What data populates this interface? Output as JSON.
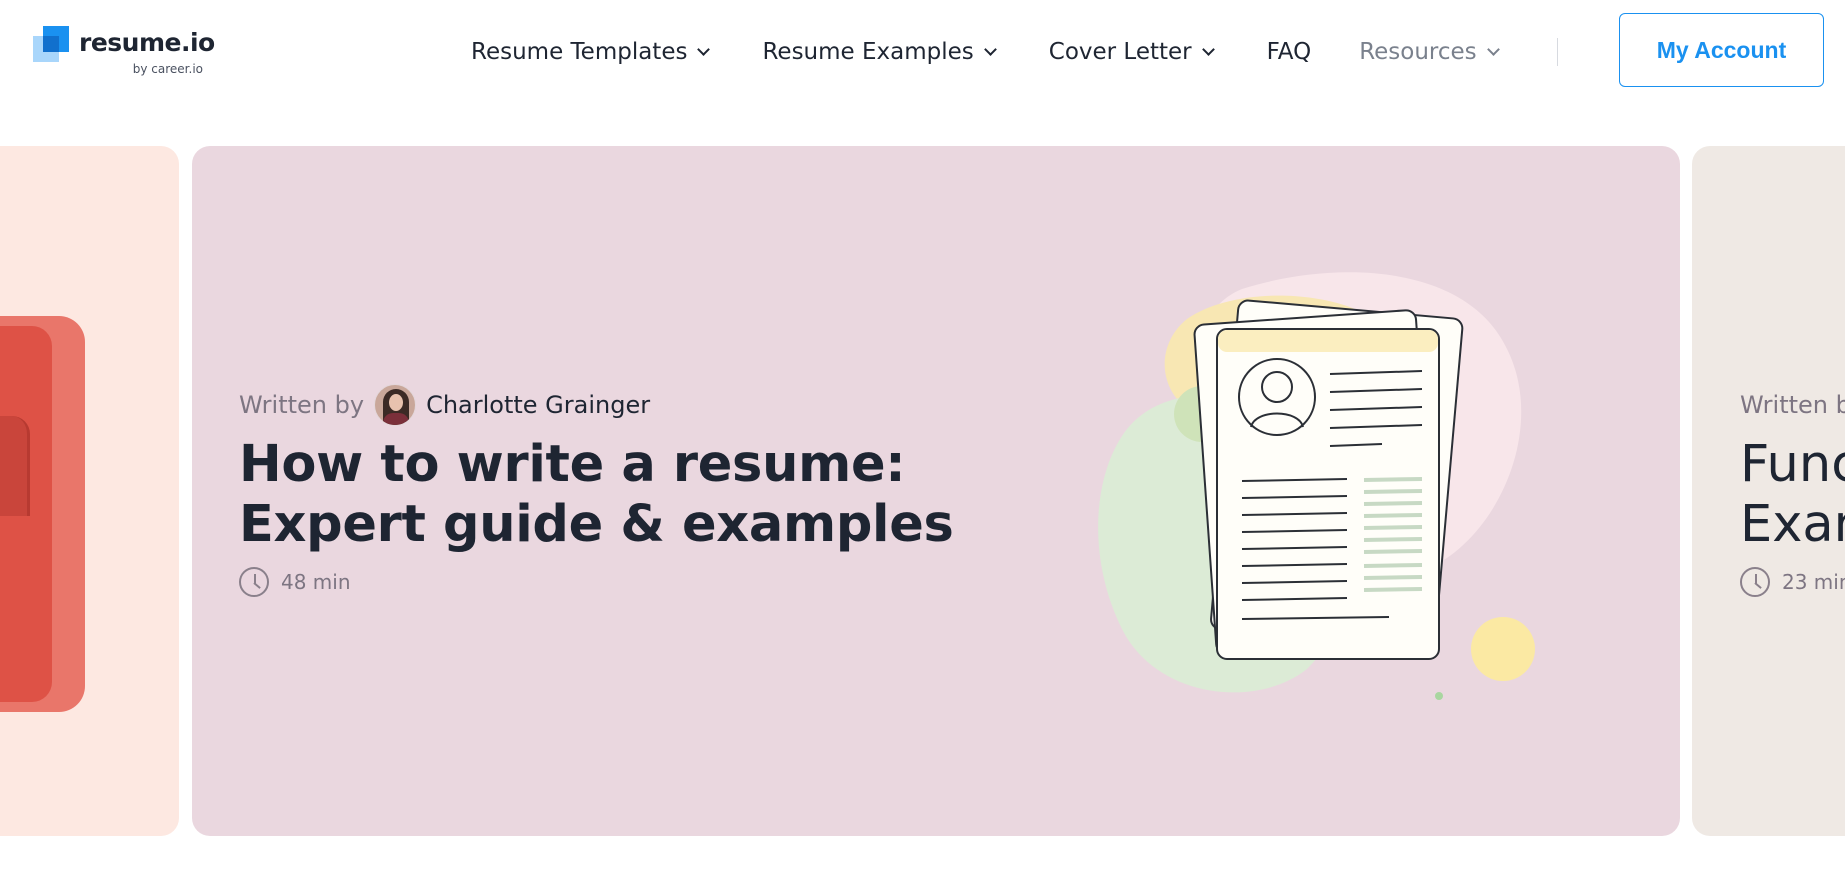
{
  "brand": {
    "name": "resume.io",
    "tagline": "by career.io",
    "accent": "#1a91f0"
  },
  "nav": {
    "items": [
      {
        "label": "Resume Templates",
        "has_dropdown": true
      },
      {
        "label": "Resume Examples",
        "has_dropdown": true
      },
      {
        "label": "Cover Letter",
        "has_dropdown": true
      },
      {
        "label": "FAQ",
        "has_dropdown": false
      },
      {
        "label": "Resources",
        "has_dropdown": true
      }
    ],
    "account_label": "My Account"
  },
  "carousel": {
    "main": {
      "written_by": "Written by",
      "author": "Charlotte Grainger",
      "title": "How to write a resume: Expert guide & examples",
      "read_time": "48 min",
      "background": "#ead7df"
    },
    "next": {
      "written_by": "Written b",
      "title_line1": "Func",
      "title_line2": "Exan",
      "read_time": "23 min",
      "background": "#efe9e4"
    },
    "prev": {
      "background": "#fde8e1"
    }
  }
}
